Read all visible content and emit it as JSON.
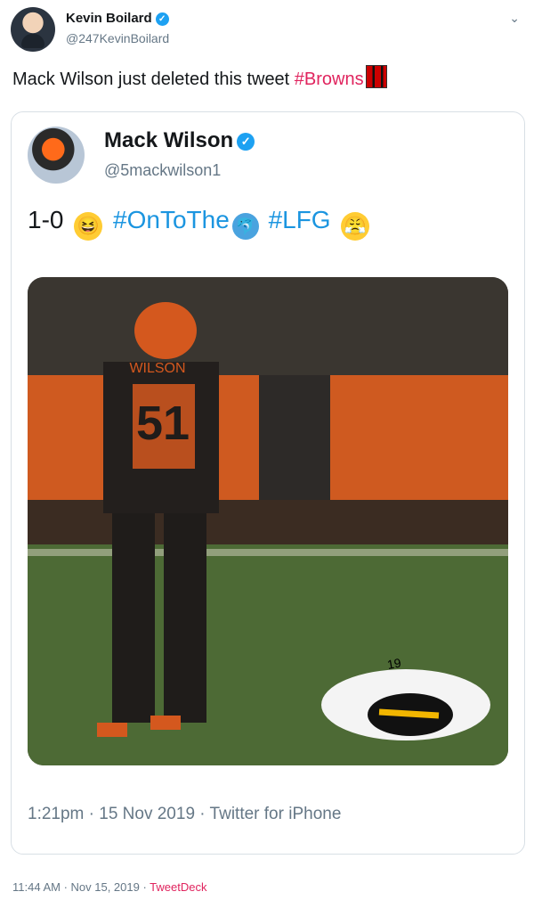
{
  "author": {
    "name": "Kevin Boilard",
    "handle": "@247KevinBoilard",
    "verified_icon": "verified-badge"
  },
  "tweet": {
    "text": "Mack Wilson just deleted this tweet ",
    "hashtag": "#Browns",
    "flag_icon": "browns-flag-emoji"
  },
  "quoted": {
    "name": "Mack Wilson",
    "handle": "@5mackwilson1",
    "text_prefix": "1-0",
    "hashtag1": "#OnToThe",
    "hashtag2": "#LFG",
    "emoji1": "😆",
    "emoji2": "😤",
    "photo_jersey_name": "WILSON",
    "photo_jersey_number": "51",
    "meta": "1:21pm · 15 Nov 2019 · Twitter for iPhone"
  },
  "footer": {
    "time": "11:44 AM · Nov 15, 2019 · ",
    "app": "TweetDeck"
  },
  "colors": {
    "hashtag_pink": "#e0245e",
    "link_blue": "#1b95e0",
    "verified_blue": "#1da1f2",
    "text_gray": "#657786"
  }
}
